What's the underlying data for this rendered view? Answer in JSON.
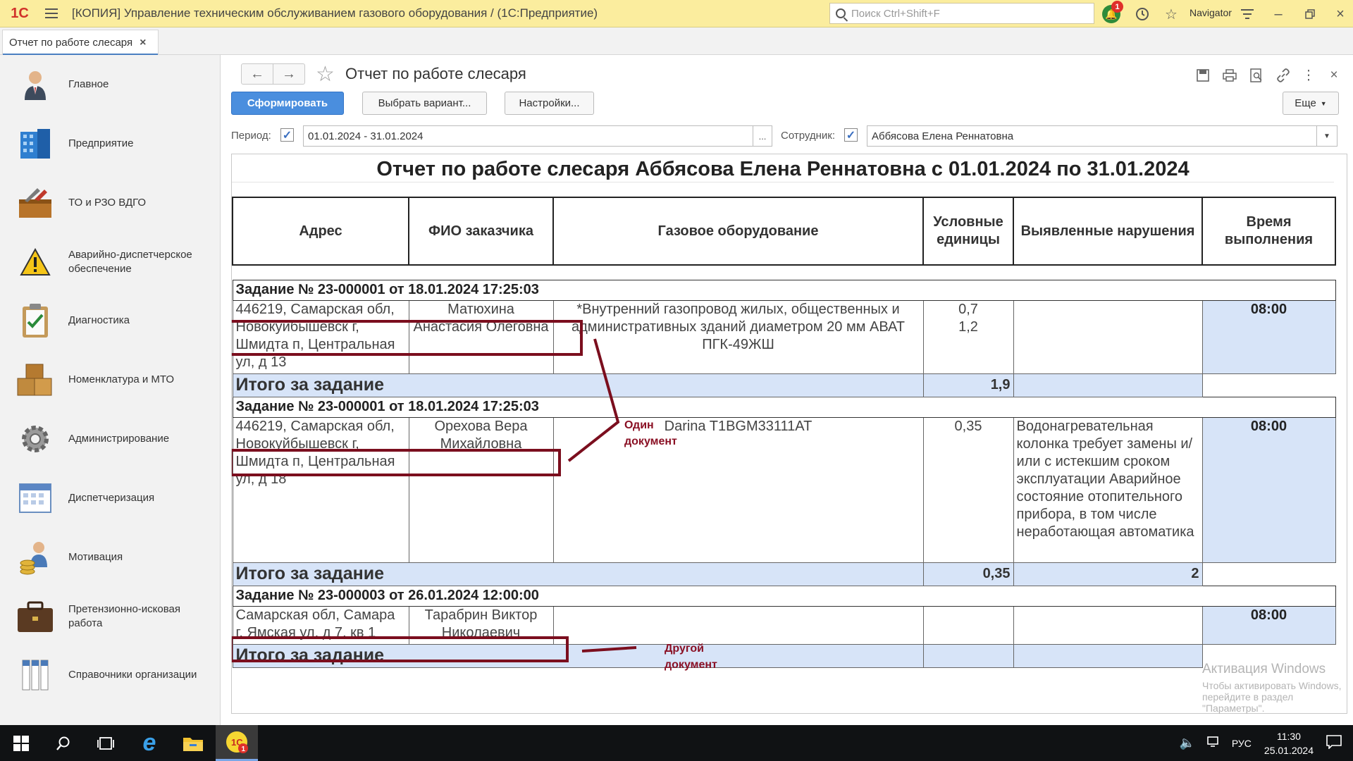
{
  "titlebar": {
    "logo": "1С",
    "title": "[КОПИЯ] Управление техническим обслуживанием газового оборудования /  (1С:Предприятие)",
    "search_placeholder": "Поиск Ctrl+Shift+F",
    "notification_count": "1",
    "navigator_label": "Navigator"
  },
  "tab": {
    "label": "Отчет по работе слесаря",
    "close": "×"
  },
  "sidebar": {
    "items": [
      {
        "label": "Главное",
        "icon": "person-icon"
      },
      {
        "label": "Предприятие",
        "icon": "building-icon"
      },
      {
        "label": "ТО и РЗО ВДГО",
        "icon": "toolbox-icon"
      },
      {
        "label": "Аварийно-диспетчерское обеспечение",
        "icon": "warning-icon"
      },
      {
        "label": "Диагностика",
        "icon": "clipboard-icon"
      },
      {
        "label": "Номенклатура и МТО",
        "icon": "boxes-icon"
      },
      {
        "label": "Администрирование",
        "icon": "gear-icon"
      },
      {
        "label": "Диспетчеризация",
        "icon": "calendar-icon"
      },
      {
        "label": "Мотивация",
        "icon": "worker-coins-icon"
      },
      {
        "label": "Претензионно-исковая работа",
        "icon": "briefcase-icon"
      },
      {
        "label": "Справочники организации",
        "icon": "binders-icon"
      }
    ]
  },
  "form": {
    "title": "Отчет по работе слесаря",
    "buttons": {
      "generate": "Сформировать",
      "variant": "Выбрать вариант...",
      "settings": "Настройки...",
      "more": "Еще"
    },
    "period_label": "Период:",
    "period_value": "01.01.2024 - 31.01.2024",
    "period_dots": "...",
    "employee_label": "Сотрудник:",
    "employee_value": "Аббясова Елена Реннатовна"
  },
  "report": {
    "title": "Отчет по работе слесаря Аббясова Елена Реннатовна с 01.01.2024 по 31.01.2024",
    "headers": [
      "Адрес",
      "ФИО заказчика",
      "Газовое оборудование",
      "Условные единицы",
      "Выявленные нарушения",
      "Время выполнения"
    ],
    "tasks": [
      {
        "header": "Задание № 23-000001 от 18.01.2024 17:25:03",
        "address": "446219, Самарская обл, Новокуйбышевск г, Шмидта п, Центральная ул, д 13",
        "customer": "Матюхина Анастасия Олеговна",
        "equipment": "*Внутренний газопровод жилых, общественных и административных зданий диаметром 20 мм АВАТ ПГК-49ЖШ",
        "units": [
          "0,7",
          "1,2"
        ],
        "violations": "",
        "time": "08:00",
        "total_label": "Итого за задание",
        "total_units": "1,9",
        "total_violations": ""
      },
      {
        "header": "Задание № 23-000001 от 18.01.2024 17:25:03",
        "address": "446219, Самарская обл, Новокуйбышевск г, Шмидта п, Центральная ул, д 18",
        "customer": "Орехова Вера Михайловна",
        "equipment": "Darina T1BGM33111AT",
        "units": [
          "0,35"
        ],
        "violations": "Водонагревательная колонка требует замены и/или с истекшим сроком эксплуатации Аварийное состояние отопительного прибора, в том числе неработающая автоматика",
        "time": "08:00",
        "total_label": "Итого за задание",
        "total_units": "0,35",
        "total_violations": "2"
      },
      {
        "header": "Задание № 23-000003 от 26.01.2024 12:00:00",
        "address": "Самарская обл, Самара г, Ямская ул, д 7, кв 1",
        "customer": "Тарабрин Виктор Николаевич",
        "equipment": "",
        "units": [],
        "violations": "",
        "time": "08:00",
        "total_label": "Итого за задание",
        "total_units": "",
        "total_violations": ""
      }
    ]
  },
  "annotations": {
    "same_doc": "Один документ",
    "other_doc": "Другой документ",
    "color": "#7b0e1e"
  },
  "watermark": {
    "line1": "Активация Windows",
    "line2": "Чтобы активировать Windows, перейдите в раздел \"Параметры\"."
  },
  "taskbar": {
    "lang": "РУС",
    "time": "11:30",
    "date": "25.01.2024"
  }
}
